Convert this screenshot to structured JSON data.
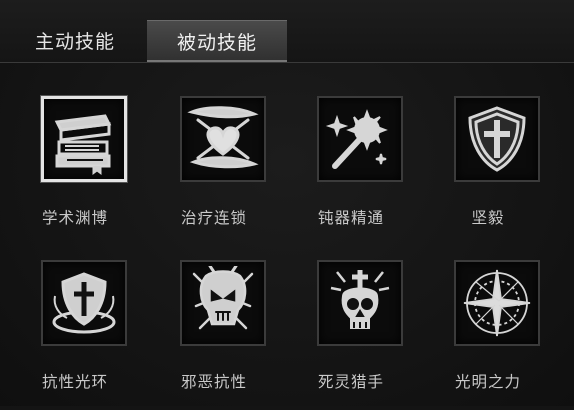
{
  "tabs": [
    {
      "label": "主动技能",
      "active": false
    },
    {
      "label": "被动技能",
      "active": true
    }
  ],
  "skills": [
    {
      "name": "学术渊博",
      "icon": "books-icon",
      "selected": true
    },
    {
      "name": "治疗连锁",
      "icon": "heart-chain-icon",
      "selected": false
    },
    {
      "name": "钝器精通",
      "icon": "mace-icon",
      "selected": false
    },
    {
      "name": "坚毅",
      "icon": "cross-shield-icon",
      "selected": false
    },
    {
      "name": "抗性光环",
      "icon": "shield-aura-icon",
      "selected": false
    },
    {
      "name": "邪恶抗性",
      "icon": "demon-skull-icon",
      "selected": false
    },
    {
      "name": "死灵猎手",
      "icon": "skull-cross-icon",
      "selected": false
    },
    {
      "name": "光明之力",
      "icon": "light-star-icon",
      "selected": false
    }
  ],
  "colors": {
    "background": "#141414",
    "tab_active": "#3c3c3c",
    "icon": "#d6d6d6",
    "label": "#c9c9c9",
    "selected_border": "#e4e4e4"
  }
}
